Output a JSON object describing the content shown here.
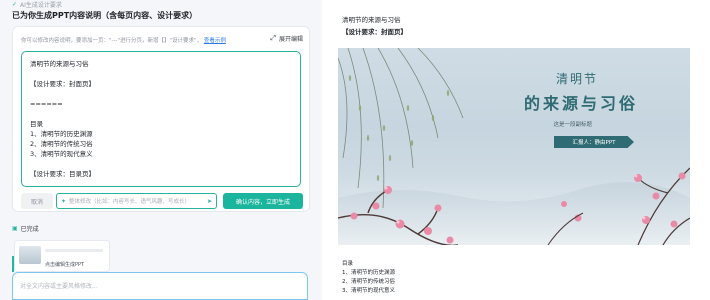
{
  "left": {
    "toprow": "AI生成设计要求",
    "title": "已为你生成PPT内容说明（含每页内容、设计要求）",
    "hint_text": "你可以修改内容说明，要添加一页：\"---\"进行分页，新增【】\"设计要求\"，",
    "hint_link": "查看示例",
    "expand_label": "展开编辑",
    "editor_lines": [
      "清明节的来源与习俗",
      "",
      "【设计要求：封面页】",
      "",
      "======",
      "",
      "目录",
      "1、清明节的历史渊源",
      "2、清明节的传统习俗",
      "3、清明节的现代意义",
      "",
      "【设计要求：目录页】"
    ],
    "cancel_label": "取消",
    "modify_placeholder": "整体修改（比如：内容写长、语气风趣、写成长）",
    "confirm_label": "确认内容，立即生成",
    "outline_label": "已完成",
    "thumb_label": "点击编辑生成PPT",
    "chat_placeholder": "对全文内容或主要风格修改..."
  },
  "right": {
    "doc_title": "清明节的来源与习俗",
    "doc_req": "【设计要求：封面页】",
    "slide": {
      "title_line1": "清明节",
      "title_line2": "的来源与习俗",
      "subtitle": "这是一段副标题",
      "badge": "汇报人：静由PPT"
    },
    "doc_lines": [
      "目录",
      "1、清明节的历史渊源",
      "2、清明节的传统习俗",
      "3、清明节的现代意义"
    ]
  },
  "colors": {
    "accent": "#1bb59d",
    "link": "#2c7be5",
    "slide_text": "#2f6b72",
    "blossom": "#e98aa6"
  }
}
